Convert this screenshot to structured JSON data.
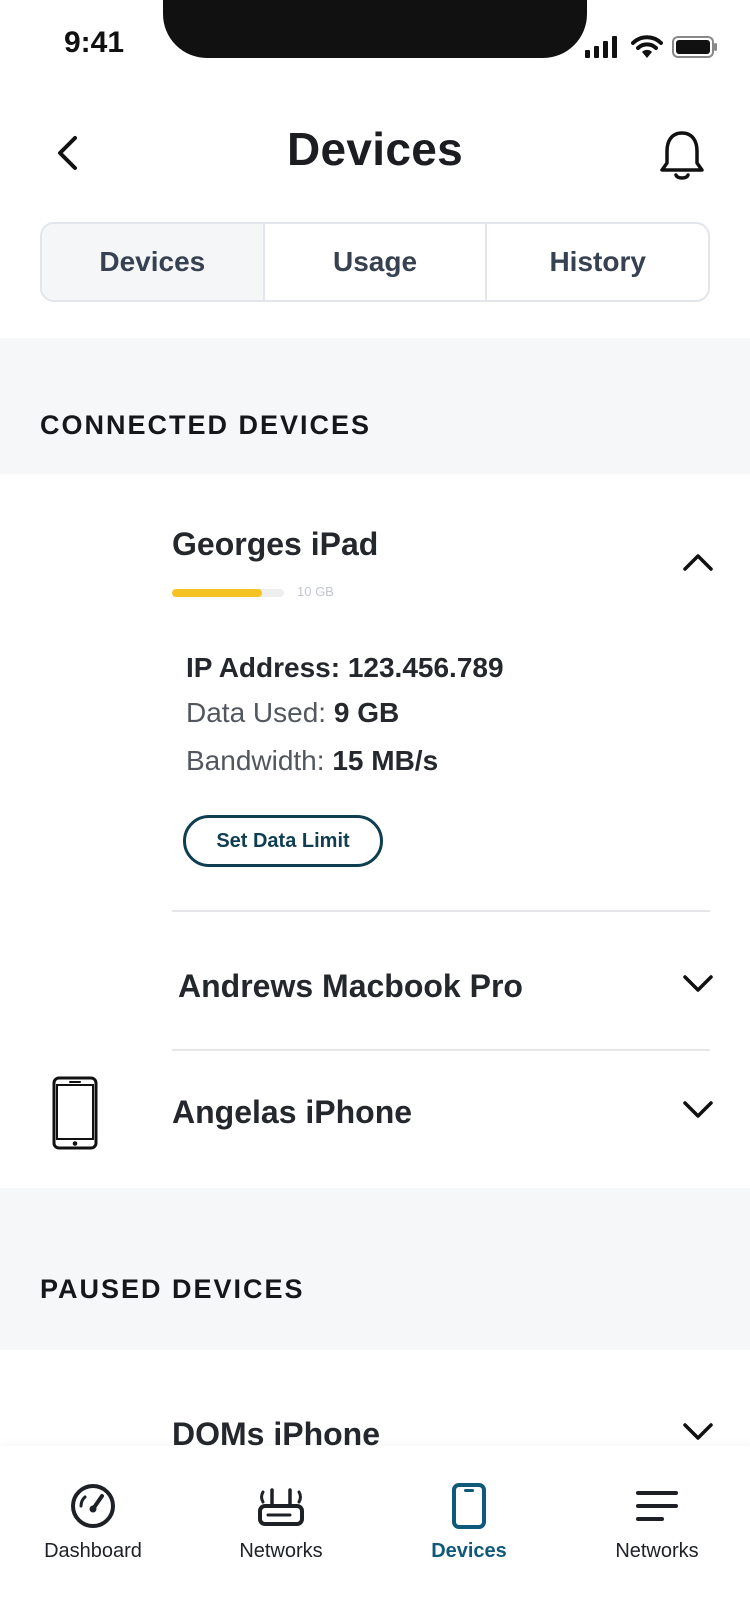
{
  "status_bar": {
    "time": "9:41"
  },
  "header": {
    "title": "Devices"
  },
  "tabs": [
    {
      "label": "Devices",
      "active": true
    },
    {
      "label": "Usage",
      "active": false
    },
    {
      "label": "History",
      "active": false
    }
  ],
  "connected": {
    "section_title": "CONNECTED DEVICES",
    "devices": [
      {
        "name": "Georges iPad",
        "expanded": true,
        "usage_fraction": 0.8,
        "usage_label": "10 GB",
        "ip_label": "IP Address:",
        "ip_value": "123.456.789",
        "data_used_label": "Data Used:",
        "data_used_value": "9 GB",
        "bandwidth_label": "Bandwidth:",
        "bandwidth_value": "15 MB/s",
        "action_label": "Set Data Limit"
      },
      {
        "name": "Andrews Macbook Pro",
        "expanded": false
      },
      {
        "name": "Angelas iPhone",
        "expanded": false,
        "icon": "phone-icon"
      }
    ]
  },
  "paused": {
    "section_title": "PAUSED DEVICES",
    "devices": [
      {
        "name": "DOMs iPhone",
        "expanded": false
      }
    ]
  },
  "bottom_nav": [
    {
      "label": "Dashboard",
      "icon": "gauge-icon",
      "active": false
    },
    {
      "label": "Networks",
      "icon": "router-icon",
      "active": false
    },
    {
      "label": "Devices",
      "icon": "tablet-icon",
      "active": true
    },
    {
      "label": "Networks",
      "icon": "menu-icon",
      "active": false
    }
  ],
  "colors": {
    "accent": "#0f5a7a",
    "usage_bar": "#f5c324",
    "section_bg": "#f6f7f9"
  }
}
